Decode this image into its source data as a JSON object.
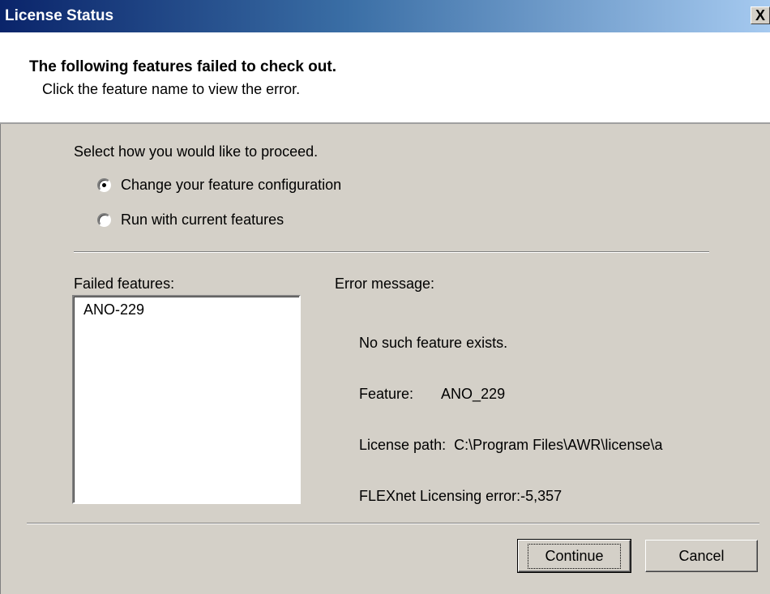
{
  "window": {
    "title": "License Status",
    "close_label": "X"
  },
  "header": {
    "title": "The following features failed to check out.",
    "subtitle": "Click the feature name to view the error."
  },
  "proceed": {
    "prompt": "Select how you would like to proceed.",
    "options": [
      {
        "label": "Change your feature configuration",
        "selected": true
      },
      {
        "label": "Run with current features",
        "selected": false
      }
    ]
  },
  "failed": {
    "label": "Failed features:",
    "items": [
      "ANO-229"
    ]
  },
  "error": {
    "label": "Error message:",
    "lines": [
      "No such feature exists.",
      "Feature:       ANO_229",
      "License path:  C:\\Program Files\\AWR\\license\\a",
      "FLEXnet Licensing error:-5,357"
    ]
  },
  "buttons": {
    "continue": "Continue",
    "cancel": "Cancel"
  }
}
